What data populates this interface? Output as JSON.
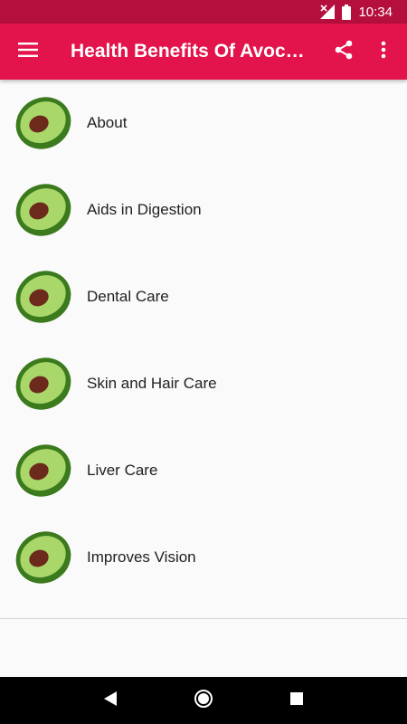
{
  "status_bar": {
    "time": "10:34",
    "icons": [
      "signal-off-icon",
      "battery-icon"
    ]
  },
  "app_bar": {
    "title": "Health Benefits Of Avocado",
    "icons": [
      "menu-icon",
      "share-icon",
      "more-vert-icon"
    ]
  },
  "list": {
    "item_icon": "avocado-icon",
    "items": [
      {
        "label": "About"
      },
      {
        "label": "Aids in Digestion"
      },
      {
        "label": "Dental Care"
      },
      {
        "label": "Skin and Hair Care"
      },
      {
        "label": "Liver Care"
      },
      {
        "label": "Improves Vision"
      }
    ]
  },
  "nav_bar": {
    "icons": [
      "back-icon",
      "home-icon",
      "recents-icon"
    ]
  },
  "colors": {
    "status_bar": "#b50f3d",
    "app_bar": "#e3134b",
    "background": "#fafafa",
    "avocado_skin": "#3c7a1e",
    "avocado_flesh": "#a9d76a",
    "avocado_pit": "#6b2a1c"
  }
}
